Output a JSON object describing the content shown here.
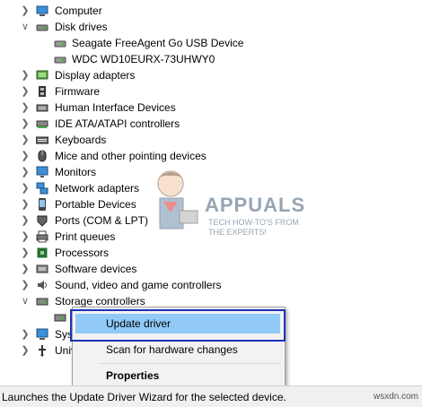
{
  "tree": {
    "items": [
      {
        "label": "Computer",
        "expanded": false,
        "icon": "computer-icon"
      },
      {
        "label": "Disk drives",
        "expanded": true,
        "icon": "disk-drive-icon"
      },
      {
        "label": "Seagate FreeAgent Go USB Device",
        "child": true,
        "icon": "drive-icon"
      },
      {
        "label": "WDC WD10EURX-73UHWY0",
        "child": true,
        "icon": "drive-icon"
      },
      {
        "label": "Display adapters",
        "expanded": false,
        "icon": "display-adapter-icon"
      },
      {
        "label": "Firmware",
        "expanded": false,
        "icon": "firmware-icon"
      },
      {
        "label": "Human Interface Devices",
        "expanded": false,
        "icon": "hid-icon"
      },
      {
        "label": "IDE ATA/ATAPI controllers",
        "expanded": false,
        "icon": "ide-icon"
      },
      {
        "label": "Keyboards",
        "expanded": false,
        "icon": "keyboard-icon"
      },
      {
        "label": "Mice and other pointing devices",
        "expanded": false,
        "icon": "mouse-icon"
      },
      {
        "label": "Monitors",
        "expanded": false,
        "icon": "monitor-icon"
      },
      {
        "label": "Network adapters",
        "expanded": false,
        "icon": "network-icon"
      },
      {
        "label": "Portable Devices",
        "expanded": false,
        "icon": "portable-icon"
      },
      {
        "label": "Ports (COM & LPT)",
        "expanded": false,
        "icon": "port-icon"
      },
      {
        "label": "Print queues",
        "expanded": false,
        "icon": "printer-icon"
      },
      {
        "label": "Processors",
        "expanded": false,
        "icon": "processor-icon"
      },
      {
        "label": "Software devices",
        "expanded": false,
        "icon": "software-icon"
      },
      {
        "label": "Sound, video and game controllers",
        "expanded": false,
        "icon": "sound-icon"
      },
      {
        "label": "Storage controllers",
        "expanded": true,
        "icon": "storage-icon"
      },
      {
        "label": "",
        "child": true,
        "icon": "storage-device-icon"
      },
      {
        "label": "Syst",
        "expanded": false,
        "icon": "system-icon"
      },
      {
        "label": "Univ",
        "expanded": false,
        "icon": "usb-icon"
      }
    ]
  },
  "context_menu": {
    "items": [
      {
        "label": "Update driver",
        "selected": true,
        "bold": false
      },
      {
        "label": "Scan for hardware changes",
        "selected": false,
        "bold": false
      },
      {
        "label": "Properties",
        "selected": false,
        "bold": true
      }
    ]
  },
  "watermark": {
    "name": "APPUALS",
    "tagline_line1": "TECH HOW-TO'S FROM",
    "tagline_line2": "THE EXPERTS!"
  },
  "status_bar": {
    "text": "Launches the Update Driver Wizard for the selected device.",
    "site": "wsxdn.com"
  },
  "colors": {
    "selection": "#91c9f7",
    "highlight_border": "#1b33b7",
    "menu_bg": "#f2f2f2"
  }
}
